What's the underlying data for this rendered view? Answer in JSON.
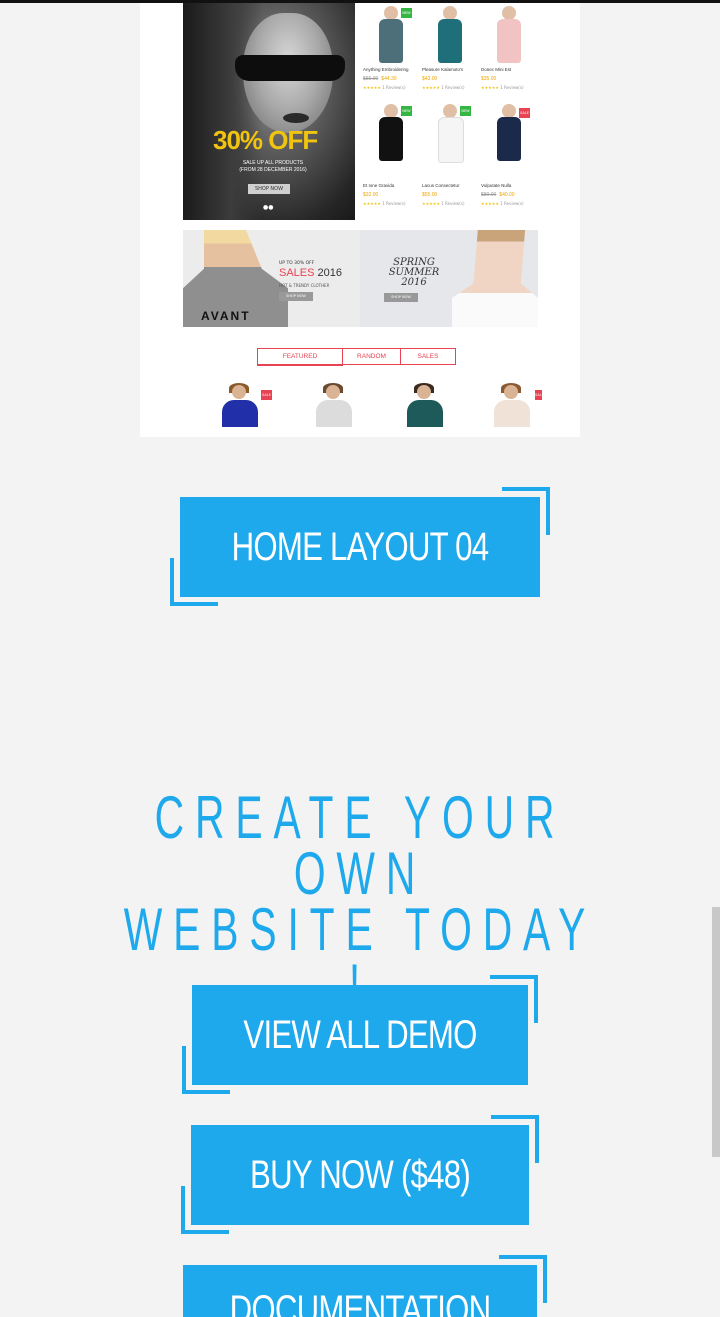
{
  "preview": {
    "hero": {
      "headline": "30% OFF",
      "sub_line1": "SALE UP ALL PRODUCTS",
      "sub_line2": "(FROM 28 DECEMBER 2016)",
      "button": "SHOP NOW",
      "dots": "●●"
    },
    "products": [
      {
        "name": "Anything Embroidering",
        "old_price": "$55.00",
        "price": "$44.30",
        "reviews": "1 Review(s)",
        "badge": "NEW",
        "body_color": "#4d6f7a"
      },
      {
        "name": "Pleasure Kalamoto's",
        "old_price": "",
        "price": "$43.00",
        "reviews": "1 Review(s)",
        "badge": "",
        "body_color": "#1f6f7a"
      },
      {
        "name": "Donec Mini Est",
        "old_price": "",
        "price": "$35.00",
        "reviews": "1 Review(s)",
        "badge": "",
        "body_color": "#f1c4c3"
      },
      {
        "name": "Et Ione Gravida",
        "old_price": "",
        "price": "$32.00",
        "reviews": "1 Review(s)",
        "badge": "NEW",
        "body_color": "#111111"
      },
      {
        "name": "Lacus Consectetur",
        "old_price": "",
        "price": "$55.00",
        "reviews": "1 Review(s)",
        "badge": "NEW",
        "body_color": "#f5f5f5"
      },
      {
        "name": "Vulputate Nulla",
        "old_price": "$80.00",
        "price": "$40.00",
        "reviews": "1 Review(s)",
        "badge": "SALE",
        "body_color": "#1b2a4a"
      }
    ],
    "stars": "★★★★★",
    "banner_left": {
      "up_to": "UP TO 30% OFF",
      "sales": "SALES",
      "year": "2016",
      "tagline": "HOT & TRENDY CLOTHER",
      "button": "SHOP NOW",
      "shirt_text": "AVANT"
    },
    "banner_right": {
      "line1": "SPRING",
      "line2": "SUMMER",
      "line3": "2016",
      "button": "SHOP NOW"
    },
    "tabs": [
      "FEATURED",
      "RANDOM",
      "SALES"
    ],
    "thumb_badge": "SALE"
  },
  "buttons": {
    "home_layout": "HOME LAYOUT 04",
    "view_all": "VIEW ALL DEMO",
    "buy_now": "BUY NOW ($48)",
    "documentation": "DOCUMENTATION"
  },
  "headline": {
    "line1": "CREATE YOUR OWN",
    "line2": "WEBSITE TODAY !"
  },
  "colors": {
    "accent": "#1ea9ed",
    "background": "#f3f3f3",
    "sale_red": "#e84352",
    "new_green": "#35b542",
    "hero_yellow": "#f1c40f"
  }
}
